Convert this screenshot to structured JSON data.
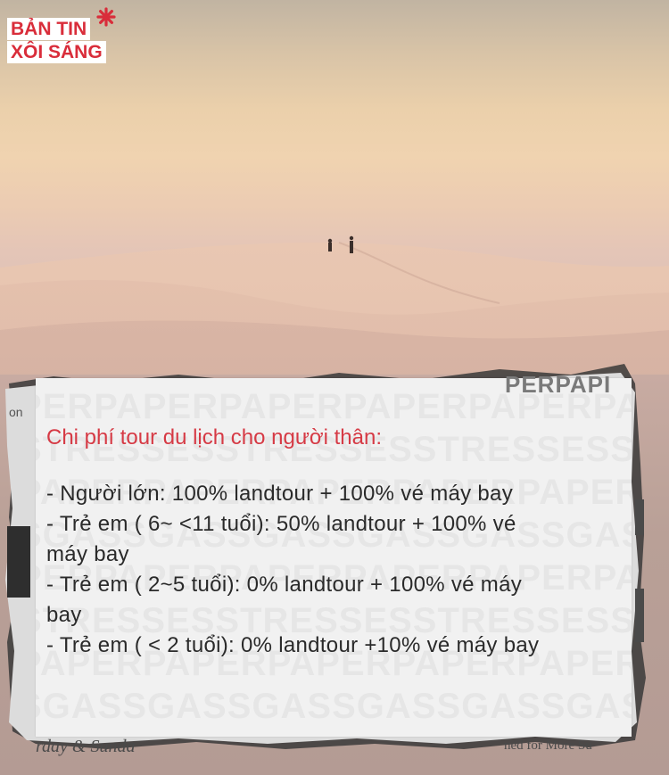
{
  "logo": {
    "line1": "BẢN TIN",
    "line2": "XÔI SÁNG",
    "star_icon": "asterisk-star-icon",
    "color": "#d92d3a"
  },
  "card": {
    "title": "Chi phí tour du lịch cho người thân:",
    "items": [
      "- Người lớn: 100% landtour + 100% vé máy bay",
      "- Trẻ em ( 6~ <11 tuổi): 50% landtour + 100% vé",
      "máy bay",
      "- Trẻ em ( 2~5 tuổi): 0% landtour + 100% vé máy",
      "bay",
      "- Trẻ em ( < 2 tuổi): 0% landtour +10% vé máy bay"
    ],
    "title_color": "#d63a45"
  },
  "paper_fragments": {
    "top_right": "PERPAPI",
    "left_edge": "on",
    "bottom_left": "rday & Sunda",
    "bottom_right": "ned for More Su"
  }
}
